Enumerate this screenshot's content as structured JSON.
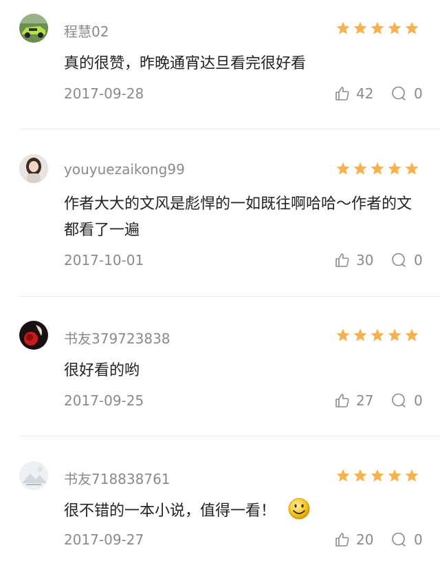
{
  "colors": {
    "star": "#f7b14e",
    "muted": "#8a8a8a",
    "divider": "#ebebeb",
    "text": "#222222"
  },
  "icons": {
    "like": "thumbs-up-icon",
    "reply": "comment-bubble-icon",
    "star": "star-icon",
    "emoji": "smiley-face-icon"
  },
  "comments": [
    {
      "username": "程慧02",
      "rating": 5,
      "text": "真的很赞，昨晚通宵达旦看完很好看",
      "date": "2017-09-28",
      "likes": "42",
      "replies": "0"
    },
    {
      "username": "youyuezaikong99",
      "rating": 5,
      "text": "作者大大的文风是彪悍的一如既往啊哈哈～作者的文都看了一遍",
      "date": "2017-10-01",
      "likes": "30",
      "replies": "0"
    },
    {
      "username": "书友379723838",
      "rating": 5,
      "text": "很好看的哟",
      "date": "2017-09-25",
      "likes": "27",
      "replies": "0"
    },
    {
      "username": "书友718838761",
      "rating": 5,
      "text": "很不错的一本小说，值得一看！",
      "date": "2017-09-27",
      "likes": "20",
      "replies": "0"
    }
  ]
}
